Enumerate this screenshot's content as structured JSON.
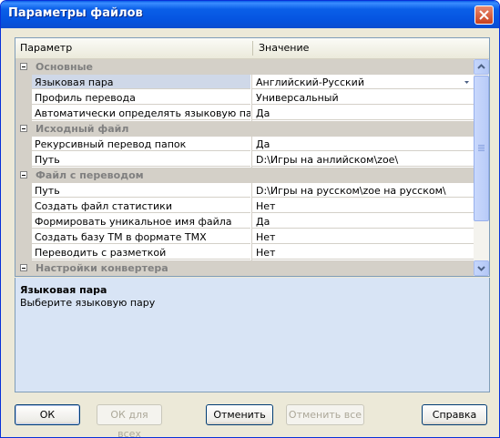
{
  "window": {
    "title": "Параметры файлов"
  },
  "grid": {
    "header": {
      "col_name": "Параметр",
      "col_value": "Значение"
    },
    "rows": [
      {
        "type": "category",
        "label": "Основные"
      },
      {
        "type": "property",
        "name": "Языковая пара",
        "value": "Английский-Русский",
        "selected": true,
        "dropdown": true
      },
      {
        "type": "property",
        "name": "Профиль перевода",
        "value": "Универсальный"
      },
      {
        "type": "property",
        "name": "Автоматически определять языковую пару ...",
        "value": "Да"
      },
      {
        "type": "category",
        "label": "Исходный файл"
      },
      {
        "type": "property",
        "name": "Рекурсивный перевод папок",
        "value": "Да"
      },
      {
        "type": "property",
        "name": "Путь",
        "value": "D:\\Игры на анлийском\\zoe\\"
      },
      {
        "type": "category",
        "label": "Файл с переводом"
      },
      {
        "type": "property",
        "name": "Путь",
        "value": "D:\\Игры на русском\\zoe на русском\\"
      },
      {
        "type": "property",
        "name": "Создать файл статистики",
        "value": "Нет"
      },
      {
        "type": "property",
        "name": "Формировать уникальное имя файла",
        "value": "Да"
      },
      {
        "type": "property",
        "name": "Создать базу ТМ в формате ТМХ",
        "value": "Нет"
      },
      {
        "type": "property",
        "name": "Переводить с разметкой",
        "value": "Нет"
      },
      {
        "type": "category",
        "label": "Настройки конвертера"
      }
    ]
  },
  "description": {
    "title": "Языковая пара",
    "text": "Выберите языковую пару"
  },
  "buttons": {
    "ok": "ОК",
    "ok_all": "ОК для всех",
    "cancel": "Отменить",
    "cancel_all": "Отменить все",
    "help": "Справка"
  },
  "colors": {
    "title_bar": "#0a5fe8",
    "category_bg": "#d4d0c8",
    "description_bg": "#d8e4f5",
    "window_bg": "#ece9d8"
  }
}
